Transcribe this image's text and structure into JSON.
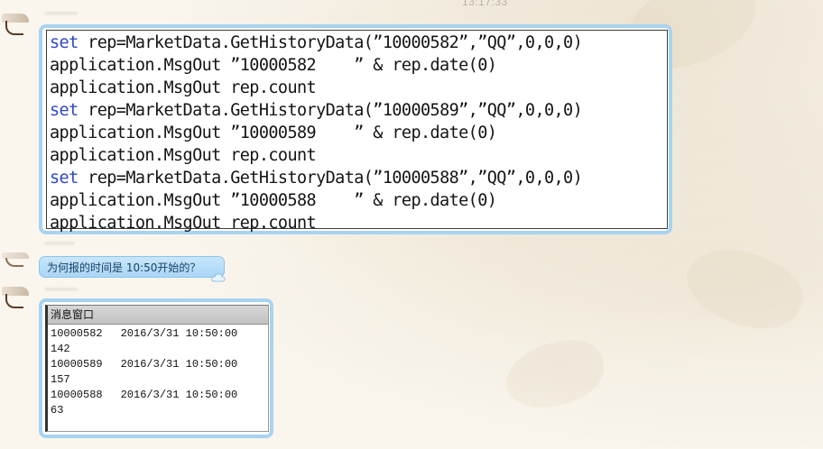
{
  "chat": {
    "timestamp": "13:17:33",
    "messages": [
      {
        "sender": "••••••••••",
        "type": "code",
        "lines": [
          {
            "keyword": "set",
            "text": " rep=MarketData.GetHistoryData(”10000582”,”QQ”,0,0,0)"
          },
          {
            "keyword": "",
            "text": "application.MsgOut ”10000582    ” & rep.date(0)"
          },
          {
            "keyword": "",
            "text": "application.MsgOut rep.count"
          },
          {
            "keyword": "set",
            "text": " rep=MarketData.GetHistoryData(”10000589”,”QQ”,0,0,0)"
          },
          {
            "keyword": "",
            "text": "application.MsgOut ”10000589    ” & rep.date(0)"
          },
          {
            "keyword": "",
            "text": "application.MsgOut rep.count"
          },
          {
            "keyword": "set",
            "text": " rep=MarketData.GetHistoryData(”10000588”,”QQ”,0,0,0)"
          },
          {
            "keyword": "",
            "text": "application.MsgOut ”10000588    ” & rep.date(0)"
          },
          {
            "keyword": "",
            "text": "application.MsgOut rep.count"
          }
        ]
      },
      {
        "sender": "•••••••••",
        "type": "text",
        "text": "为何报的时间是 10:50开始的？",
        "icon": "cloud-icon"
      },
      {
        "sender": "••••••••••",
        "type": "image",
        "window_title": "消息窗口",
        "output": [
          {
            "code": "10000582",
            "time": "2016/3/31 10:50:00"
          },
          {
            "code": "142",
            "time": ""
          },
          {
            "code": "10000589",
            "time": "2016/3/31 10:50:00"
          },
          {
            "code": "157",
            "time": ""
          },
          {
            "code": "10000588",
            "time": "2016/3/31 10:50:00"
          },
          {
            "code": "63",
            "time": ""
          }
        ]
      }
    ]
  },
  "colors": {
    "bubble_border": "#a8d3f0",
    "keyword": "#2f47c4",
    "question_bg": "#b8ddf7"
  }
}
